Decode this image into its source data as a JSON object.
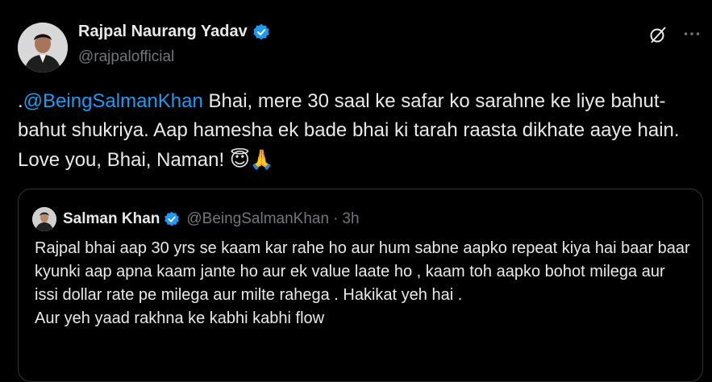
{
  "author": {
    "name": "Rajpal Naurang Yadav",
    "handle": "@rajpalofficial"
  },
  "tweet": {
    "prefix": ".",
    "mention": "@BeingSalmanKhan",
    "text": " Bhai, mere 30 saal ke safar ko sarahne ke liye bahut-bahut shukriya. Aap hamesha ek bade bhai ki tarah raasta dikhate aaye hain. Love you, Bhai, Naman! ",
    "emojis": "😇🙏"
  },
  "quoted_tweet": {
    "name": "Salman Khan",
    "handle": "@BeingSalmanKhan",
    "separator": "·",
    "time": "3h",
    "text_line1": "Rajpal bhai aap 30 yrs se kaam kar rahe ho aur hum sabne aapko repeat kiya hai baar baar kyunki aap apna kaam jante ho aur ek value laate ho , kaam toh aapko bohot milega aur issi dollar rate pe milega aur milte rahega . Hakikat yeh hai .",
    "text_line2": "Aur yeh yaad rakhna ke kabhi kabhi flow"
  },
  "icons": {
    "verified": "verified-badge-icon",
    "grok": "grok-icon",
    "more": "more-options-icon"
  },
  "colors": {
    "background": "#000000",
    "text": "#e7e9ea",
    "secondary": "#71767b",
    "accent": "#1d9bf0",
    "border": "#2f3336"
  }
}
